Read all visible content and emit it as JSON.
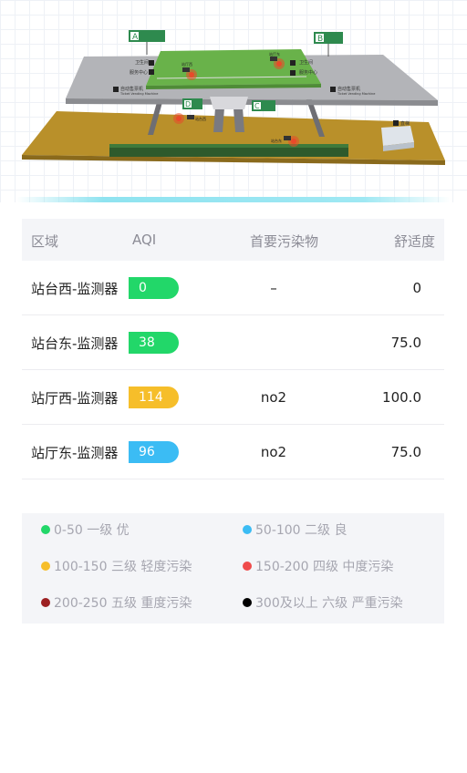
{
  "map": {
    "exit_a": "A",
    "exit_b": "B",
    "exit_d": "D",
    "exit_c": "C",
    "sign_ticket": "自动售票机",
    "sign_ticket_en": "Ticket Vending Machine",
    "sign_ticket2": "自动售票机",
    "sign_ticket2_en": "Ticket Vending Machine",
    "sign_toilet": "卫生间",
    "sign_service": "服务中心",
    "sign_elevator": "直梯",
    "monitor_labels": [
      "站厅西",
      "站厅东",
      "站台西",
      "站台东"
    ]
  },
  "table": {
    "headers": {
      "area": "区域",
      "aqi": "AQI",
      "pollutant": "首要污染物",
      "comfort": "舒适度"
    },
    "rows": [
      {
        "name": "站台西-监测器",
        "aqi": "0",
        "color": "#22d769",
        "pollutant": "–",
        "comfort": "0"
      },
      {
        "name": "站台东-监测器",
        "aqi": "38",
        "color": "#22d769",
        "pollutant": "",
        "comfort": "75.0"
      },
      {
        "name": "站厅西-监测器",
        "aqi": "114",
        "color": "#f6be2a",
        "pollutant": "no2",
        "comfort": "100.0"
      },
      {
        "name": "站厅东-监测器",
        "aqi": "96",
        "color": "#3bbcf4",
        "pollutant": "no2",
        "comfort": "75.0"
      }
    ]
  },
  "legend": [
    {
      "label": "0-50 一级 优",
      "color": "#22d769"
    },
    {
      "label": "50-100 二级 良",
      "color": "#3bbcf4"
    },
    {
      "label": "100-150 三级 轻度污染",
      "color": "#f6be2a"
    },
    {
      "label": "150-200 四级 中度污染",
      "color": "#ef4b4b"
    },
    {
      "label": "200-250 五级 重度污染",
      "color": "#9c2022"
    },
    {
      "label": "300及以上 六级 严重污染",
      "color": "#000000"
    }
  ]
}
